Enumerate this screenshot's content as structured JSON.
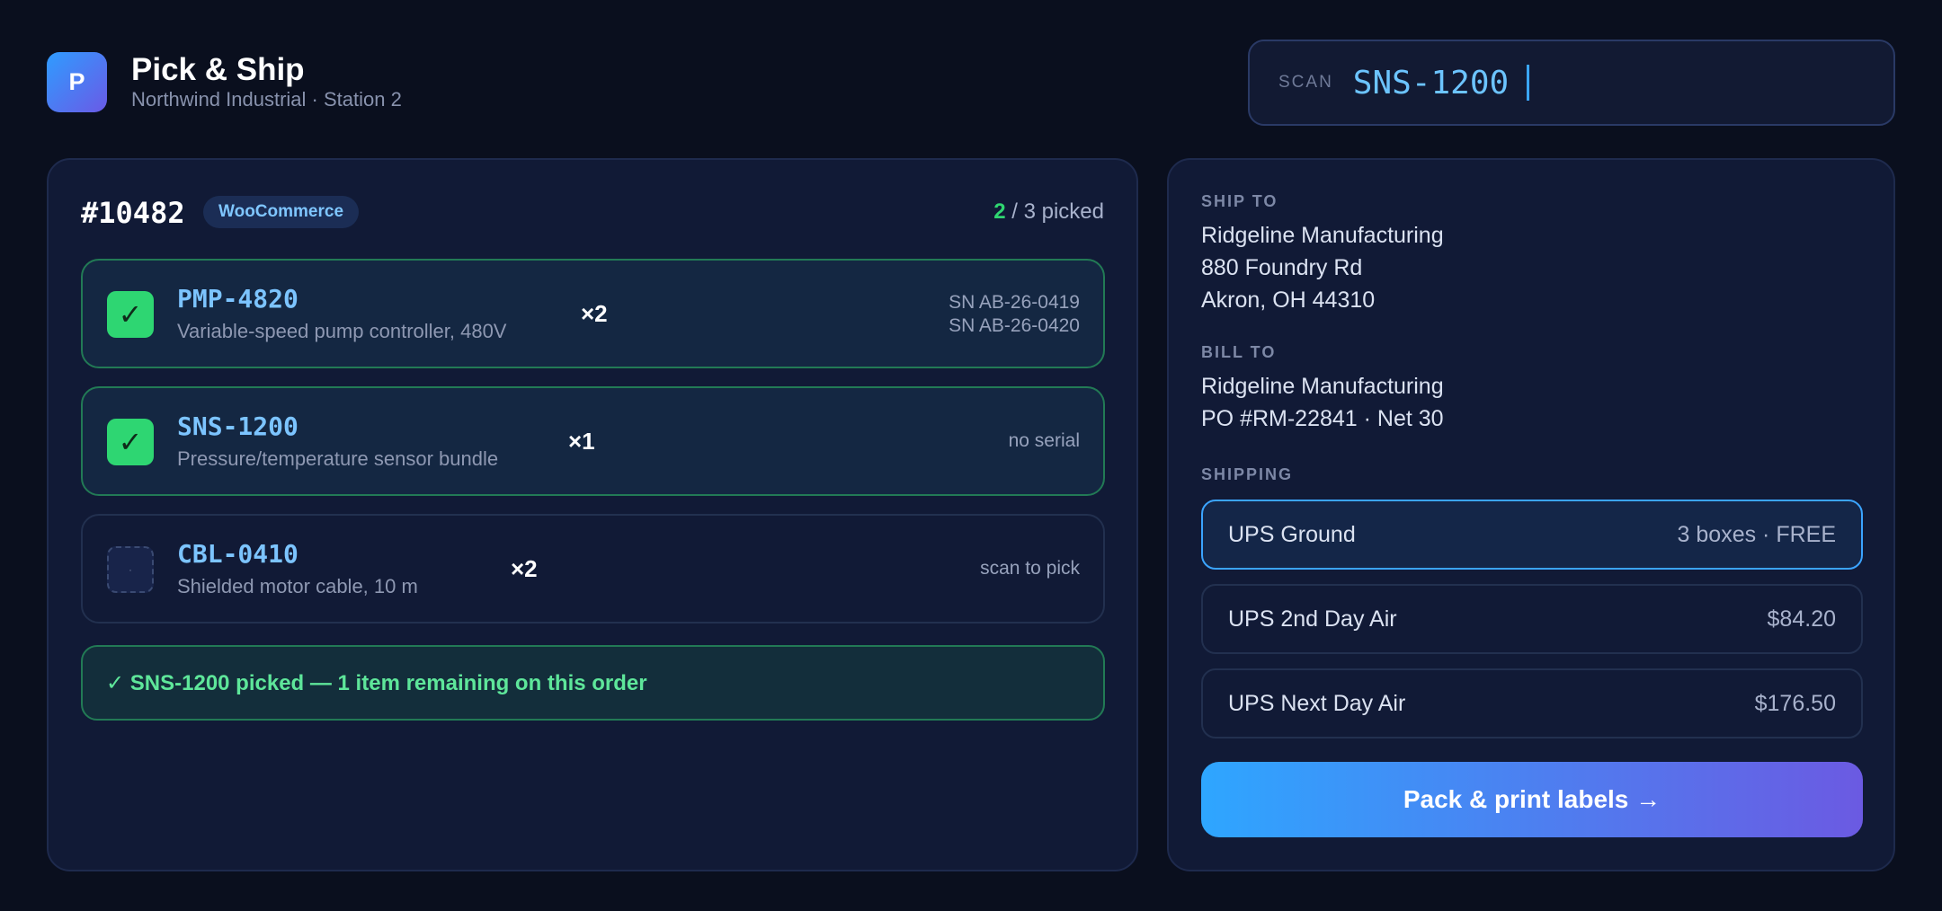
{
  "app": {
    "logo_letter": "P",
    "title": "Pick & Ship",
    "subtitle": "Northwind Industrial · Station 2"
  },
  "scan": {
    "label": "SCAN",
    "value": "SNS-1200"
  },
  "order": {
    "number": "#10482",
    "source": "WooCommerce",
    "picked": "2",
    "picked_suffix": " / 3 picked",
    "items": [
      {
        "sku": "PMP-4820",
        "description": "Variable-speed pump controller, 480V",
        "qty": "×2",
        "status": "picked",
        "serials": [
          "SN AB-26-0419",
          "SN AB-26-0420"
        ]
      },
      {
        "sku": "SNS-1200",
        "description": "Pressure/temperature sensor bundle",
        "qty": "×1",
        "status": "picked",
        "note": "no serial"
      },
      {
        "sku": "CBL-0410",
        "description": "Shielded motor cable, 10 m",
        "qty": "×2",
        "status": "pending",
        "note": "scan to pick"
      }
    ],
    "toast": "✓ SNS-1200 picked — 1 item remaining on this order"
  },
  "ship_to": {
    "label": "SHIP TO",
    "lines": [
      "Ridgeline Manufacturing",
      "880 Foundry Rd",
      "Akron, OH 44310"
    ]
  },
  "bill_to": {
    "label": "BILL TO",
    "lines": [
      "Ridgeline Manufacturing",
      "PO #RM-22841 · Net 30"
    ]
  },
  "shipping": {
    "label": "SHIPPING",
    "options": [
      {
        "name": "UPS Ground",
        "price": "3 boxes · FREE",
        "selected": true
      },
      {
        "name": "UPS 2nd Day Air",
        "price": "$84.20",
        "selected": false
      },
      {
        "name": "UPS Next Day Air",
        "price": "$176.50",
        "selected": false
      }
    ]
  },
  "cta_label": "Pack & print labels →",
  "icons": {
    "check": "✓",
    "pending": "·"
  },
  "colors": {
    "background": "#0a0f1e",
    "accent": "#3ba4ff",
    "success": "#2ed672",
    "gradient_start": "#2ea6ff",
    "gradient_end": "#6b5ae2"
  }
}
